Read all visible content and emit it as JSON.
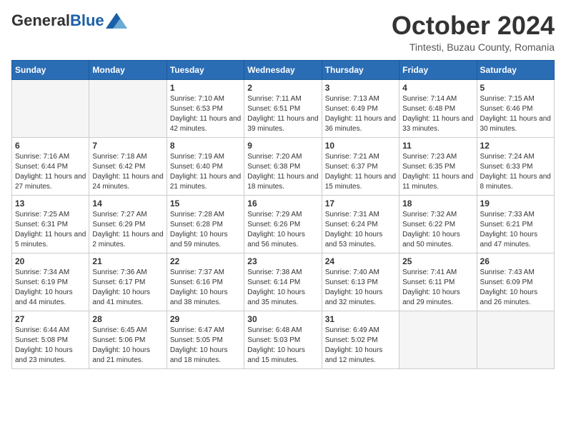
{
  "header": {
    "logo": {
      "general": "General",
      "blue": "Blue"
    },
    "title": "October 2024",
    "location": "Tintesti, Buzau County, Romania"
  },
  "weekdays": [
    "Sunday",
    "Monday",
    "Tuesday",
    "Wednesday",
    "Thursday",
    "Friday",
    "Saturday"
  ],
  "weeks": [
    [
      {
        "day": "",
        "empty": true
      },
      {
        "day": "",
        "empty": true
      },
      {
        "day": "1",
        "sunrise": "Sunrise: 7:10 AM",
        "sunset": "Sunset: 6:53 PM",
        "daylight": "Daylight: 11 hours and 42 minutes."
      },
      {
        "day": "2",
        "sunrise": "Sunrise: 7:11 AM",
        "sunset": "Sunset: 6:51 PM",
        "daylight": "Daylight: 11 hours and 39 minutes."
      },
      {
        "day": "3",
        "sunrise": "Sunrise: 7:13 AM",
        "sunset": "Sunset: 6:49 PM",
        "daylight": "Daylight: 11 hours and 36 minutes."
      },
      {
        "day": "4",
        "sunrise": "Sunrise: 7:14 AM",
        "sunset": "Sunset: 6:48 PM",
        "daylight": "Daylight: 11 hours and 33 minutes."
      },
      {
        "day": "5",
        "sunrise": "Sunrise: 7:15 AM",
        "sunset": "Sunset: 6:46 PM",
        "daylight": "Daylight: 11 hours and 30 minutes."
      }
    ],
    [
      {
        "day": "6",
        "sunrise": "Sunrise: 7:16 AM",
        "sunset": "Sunset: 6:44 PM",
        "daylight": "Daylight: 11 hours and 27 minutes."
      },
      {
        "day": "7",
        "sunrise": "Sunrise: 7:18 AM",
        "sunset": "Sunset: 6:42 PM",
        "daylight": "Daylight: 11 hours and 24 minutes."
      },
      {
        "day": "8",
        "sunrise": "Sunrise: 7:19 AM",
        "sunset": "Sunset: 6:40 PM",
        "daylight": "Daylight: 11 hours and 21 minutes."
      },
      {
        "day": "9",
        "sunrise": "Sunrise: 7:20 AM",
        "sunset": "Sunset: 6:38 PM",
        "daylight": "Daylight: 11 hours and 18 minutes."
      },
      {
        "day": "10",
        "sunrise": "Sunrise: 7:21 AM",
        "sunset": "Sunset: 6:37 PM",
        "daylight": "Daylight: 11 hours and 15 minutes."
      },
      {
        "day": "11",
        "sunrise": "Sunrise: 7:23 AM",
        "sunset": "Sunset: 6:35 PM",
        "daylight": "Daylight: 11 hours and 11 minutes."
      },
      {
        "day": "12",
        "sunrise": "Sunrise: 7:24 AM",
        "sunset": "Sunset: 6:33 PM",
        "daylight": "Daylight: 11 hours and 8 minutes."
      }
    ],
    [
      {
        "day": "13",
        "sunrise": "Sunrise: 7:25 AM",
        "sunset": "Sunset: 6:31 PM",
        "daylight": "Daylight: 11 hours and 5 minutes."
      },
      {
        "day": "14",
        "sunrise": "Sunrise: 7:27 AM",
        "sunset": "Sunset: 6:29 PM",
        "daylight": "Daylight: 11 hours and 2 minutes."
      },
      {
        "day": "15",
        "sunrise": "Sunrise: 7:28 AM",
        "sunset": "Sunset: 6:28 PM",
        "daylight": "Daylight: 10 hours and 59 minutes."
      },
      {
        "day": "16",
        "sunrise": "Sunrise: 7:29 AM",
        "sunset": "Sunset: 6:26 PM",
        "daylight": "Daylight: 10 hours and 56 minutes."
      },
      {
        "day": "17",
        "sunrise": "Sunrise: 7:31 AM",
        "sunset": "Sunset: 6:24 PM",
        "daylight": "Daylight: 10 hours and 53 minutes."
      },
      {
        "day": "18",
        "sunrise": "Sunrise: 7:32 AM",
        "sunset": "Sunset: 6:22 PM",
        "daylight": "Daylight: 10 hours and 50 minutes."
      },
      {
        "day": "19",
        "sunrise": "Sunrise: 7:33 AM",
        "sunset": "Sunset: 6:21 PM",
        "daylight": "Daylight: 10 hours and 47 minutes."
      }
    ],
    [
      {
        "day": "20",
        "sunrise": "Sunrise: 7:34 AM",
        "sunset": "Sunset: 6:19 PM",
        "daylight": "Daylight: 10 hours and 44 minutes."
      },
      {
        "day": "21",
        "sunrise": "Sunrise: 7:36 AM",
        "sunset": "Sunset: 6:17 PM",
        "daylight": "Daylight: 10 hours and 41 minutes."
      },
      {
        "day": "22",
        "sunrise": "Sunrise: 7:37 AM",
        "sunset": "Sunset: 6:16 PM",
        "daylight": "Daylight: 10 hours and 38 minutes."
      },
      {
        "day": "23",
        "sunrise": "Sunrise: 7:38 AM",
        "sunset": "Sunset: 6:14 PM",
        "daylight": "Daylight: 10 hours and 35 minutes."
      },
      {
        "day": "24",
        "sunrise": "Sunrise: 7:40 AM",
        "sunset": "Sunset: 6:13 PM",
        "daylight": "Daylight: 10 hours and 32 minutes."
      },
      {
        "day": "25",
        "sunrise": "Sunrise: 7:41 AM",
        "sunset": "Sunset: 6:11 PM",
        "daylight": "Daylight: 10 hours and 29 minutes."
      },
      {
        "day": "26",
        "sunrise": "Sunrise: 7:43 AM",
        "sunset": "Sunset: 6:09 PM",
        "daylight": "Daylight: 10 hours and 26 minutes."
      }
    ],
    [
      {
        "day": "27",
        "sunrise": "Sunrise: 6:44 AM",
        "sunset": "Sunset: 5:08 PM",
        "daylight": "Daylight: 10 hours and 23 minutes."
      },
      {
        "day": "28",
        "sunrise": "Sunrise: 6:45 AM",
        "sunset": "Sunset: 5:06 PM",
        "daylight": "Daylight: 10 hours and 21 minutes."
      },
      {
        "day": "29",
        "sunrise": "Sunrise: 6:47 AM",
        "sunset": "Sunset: 5:05 PM",
        "daylight": "Daylight: 10 hours and 18 minutes."
      },
      {
        "day": "30",
        "sunrise": "Sunrise: 6:48 AM",
        "sunset": "Sunset: 5:03 PM",
        "daylight": "Daylight: 10 hours and 15 minutes."
      },
      {
        "day": "31",
        "sunrise": "Sunrise: 6:49 AM",
        "sunset": "Sunset: 5:02 PM",
        "daylight": "Daylight: 10 hours and 12 minutes."
      },
      {
        "day": "",
        "empty": true
      },
      {
        "day": "",
        "empty": true
      }
    ]
  ]
}
